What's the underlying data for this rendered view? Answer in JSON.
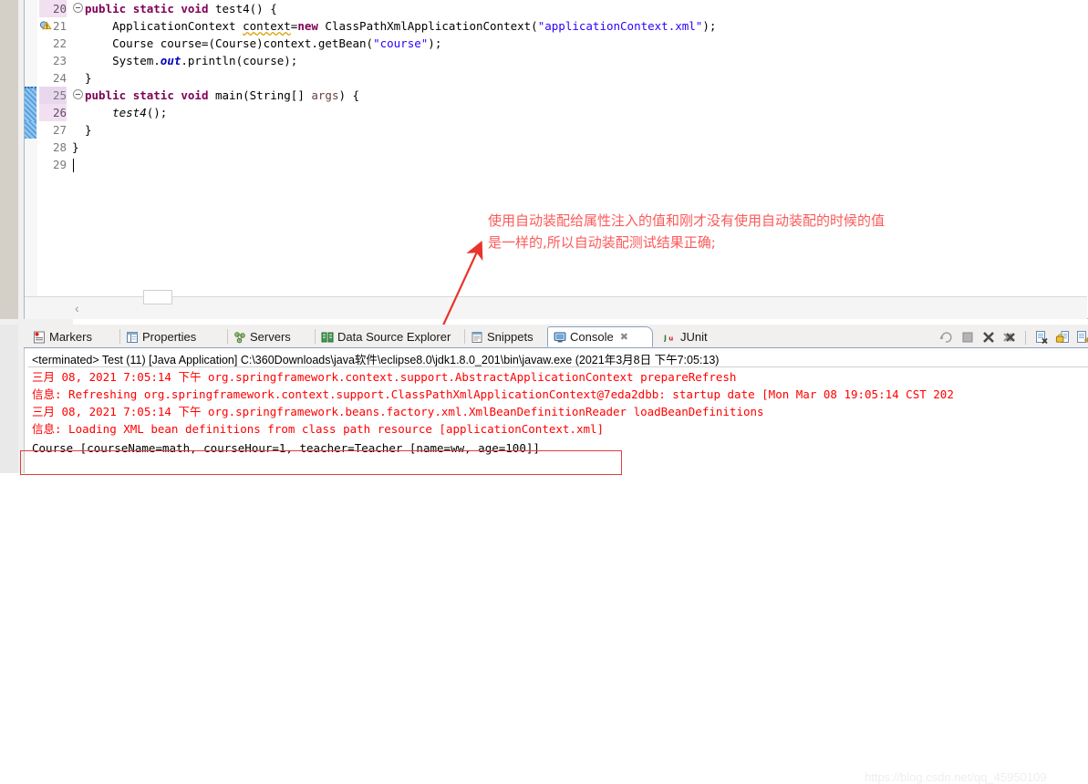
{
  "editor": {
    "lines": [
      {
        "num": "20",
        "indent": 0,
        "folding": true,
        "highlight": true,
        "text": "    public static void test4() {"
      },
      {
        "num": "21",
        "indent": 0,
        "warning": true,
        "highlight": false,
        "text": "        ApplicationContext context=new ClassPathXmlApplicationContext(\"applicationContext.xml\");"
      },
      {
        "num": "22",
        "indent": 0,
        "text": "        Course course=(Course)context.getBean(\"course\");"
      },
      {
        "num": "23",
        "indent": 0,
        "text": "        System.out.println(course);"
      },
      {
        "num": "24",
        "indent": 0,
        "text": "    }"
      },
      {
        "num": "25",
        "indent": 0,
        "folding": true,
        "changed": true,
        "text": "    public static void main(String[] args) {"
      },
      {
        "num": "26",
        "indent": 0,
        "changed": true,
        "highlight": true,
        "text": "        test4();"
      },
      {
        "num": "27",
        "indent": 0,
        "changed": true,
        "text": "    }"
      },
      {
        "num": "28",
        "indent": 0,
        "text": "}"
      },
      {
        "num": "29",
        "indent": 0,
        "text": "",
        "current": true
      }
    ],
    "collapse_arrow": "‹"
  },
  "annotation": {
    "line1": "使用自动装配给属性注入的值和刚才没有使用自动装配的时候的值",
    "line2": "是一样的,所以自动装配测试结果正确;",
    "color": "#fb5a5a"
  },
  "panel": {
    "tabs": [
      {
        "label": "Markers",
        "icon": "markers-icon",
        "active": false
      },
      {
        "label": "Properties",
        "icon": "properties-icon",
        "active": false
      },
      {
        "label": "Servers",
        "icon": "servers-icon",
        "active": false
      },
      {
        "label": "Data Source Explorer",
        "icon": "data-source-explorer-icon",
        "active": false
      },
      {
        "label": "Snippets",
        "icon": "snippets-icon",
        "active": false
      },
      {
        "label": "Console",
        "icon": "console-icon",
        "active": true,
        "close": "✖"
      },
      {
        "label": "JUnit",
        "icon": "junit-icon",
        "active": false
      }
    ],
    "toolbar_icons": [
      "relaunch-icon",
      "terminate-icon",
      "remove-launch-icon",
      "remove-all-terminated-icon",
      "clear-console-icon",
      "scroll-lock-icon",
      "pin-console-icon"
    ],
    "terminated_line": "<terminated> Test (11) [Java Application] C:\\360Downloads\\java软件\\eclipse8.0\\jdk1.8.0_201\\bin\\javaw.exe (2021年3月8日 下午7:05:13)",
    "console_lines": [
      {
        "text": "三月 08, 2021 7:05:14 下午 org.springframework.context.support.AbstractApplicationContext prepareRefresh",
        "color": "red"
      },
      {
        "text": "信息: Refreshing org.springframework.context.support.ClassPathXmlApplicationContext@7eda2dbb: startup date [Mon Mar 08 19:05:14 CST 202",
        "color": "red"
      },
      {
        "text": "三月 08, 2021 7:05:14 下午 org.springframework.beans.factory.xml.XmlBeanDefinitionReader loadBeanDefinitions",
        "color": "red"
      },
      {
        "text": "信息: Loading XML bean definitions from class path resource [applicationContext.xml]",
        "color": "red"
      },
      {
        "text": "Course [courseName=math, courseHour=1, teacher=Teacher [name=ww, age=100]]",
        "color": "black"
      }
    ]
  },
  "watermark": "https://blog.csdn.net/qq_45950109"
}
